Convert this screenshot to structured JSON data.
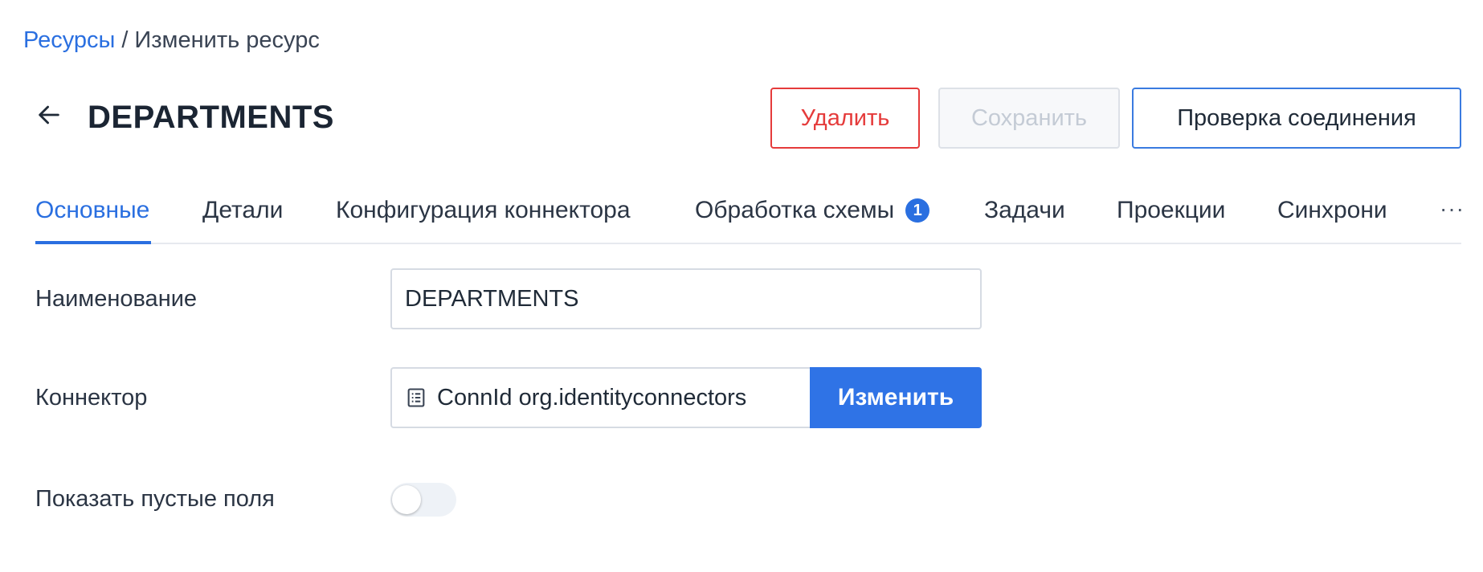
{
  "breadcrumb": {
    "link": "Ресурсы",
    "separator": "/",
    "current": "Изменить ресурс"
  },
  "header": {
    "title": "DEPARTMENTS",
    "back_icon": "arrow-left-icon",
    "buttons": {
      "delete": "Удалить",
      "save": "Сохранить",
      "check_connection": "Проверка соединения"
    }
  },
  "tabs": [
    {
      "label": "Основные",
      "active": true
    },
    {
      "label": "Детали"
    },
    {
      "label": "Конфигурация коннектора"
    },
    {
      "label": "Обработка схемы",
      "badge": "1"
    },
    {
      "label": "Задачи"
    },
    {
      "label": "Проекции"
    },
    {
      "label": "Синхрони"
    }
  ],
  "more_label": "···",
  "form": {
    "name": {
      "label": "Наименование",
      "value": "DEPARTMENTS"
    },
    "connector": {
      "label": "Коннектор",
      "value": "ConnId org.identityconnectors",
      "icon": "list-document-icon",
      "button": "Изменить"
    },
    "show_empty": {
      "label": "Показать пустые поля",
      "enabled": false
    }
  },
  "colors": {
    "accent": "#2a6fe0",
    "danger": "#e53b3b",
    "disabled_text": "#c4cbd5"
  }
}
